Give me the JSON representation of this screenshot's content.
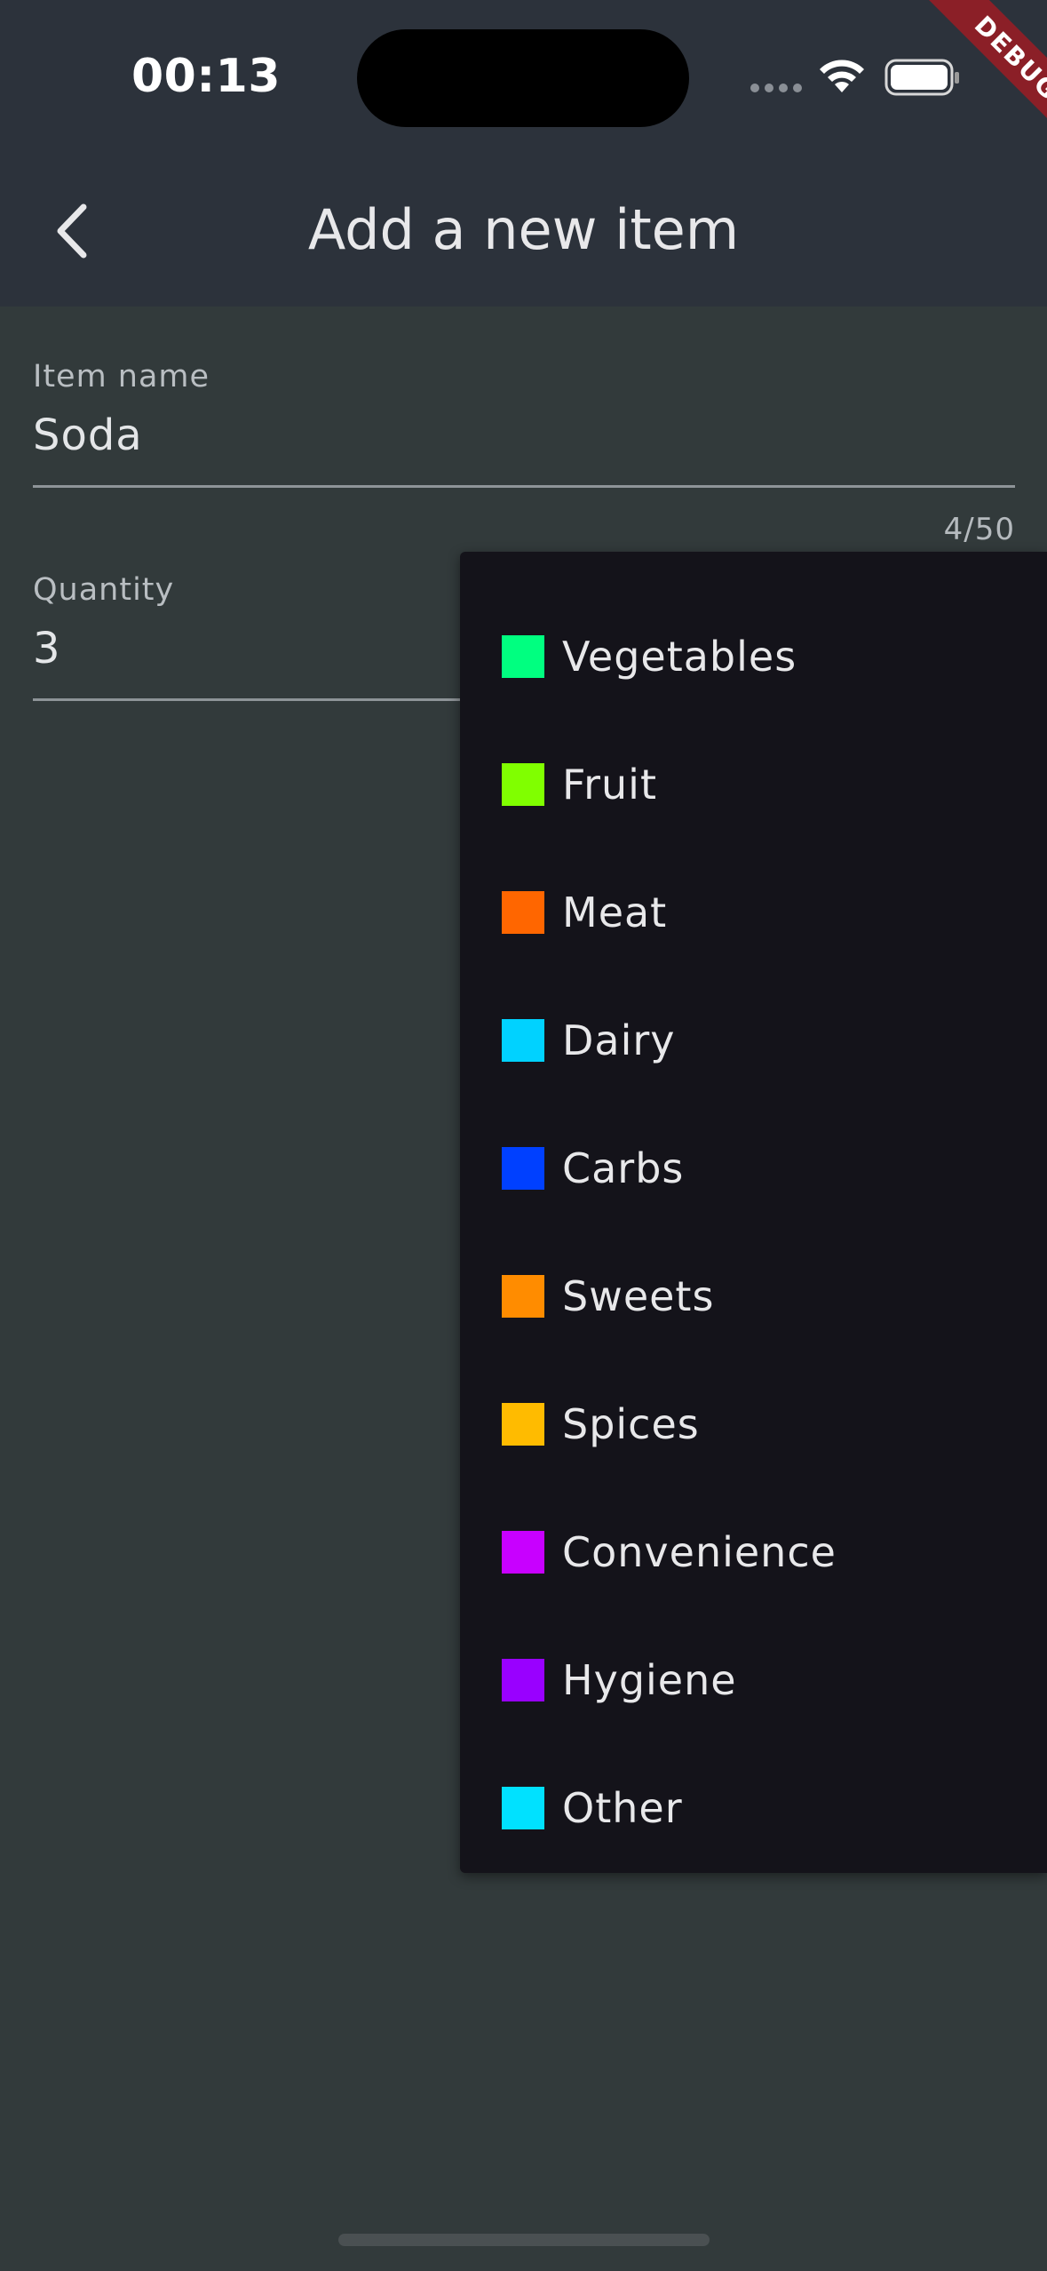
{
  "status_bar": {
    "time": "00:13"
  },
  "debug_banner": "DEBUG",
  "app_bar": {
    "title": "Add a new item",
    "back_icon": "chevron-left-icon"
  },
  "form": {
    "item_name": {
      "label": "Item name",
      "value": "Soda",
      "counter": "4/50"
    },
    "quantity": {
      "label": "Quantity",
      "value": "3"
    }
  },
  "category_dropdown": {
    "options": [
      {
        "label": "Vegetables",
        "color": "#00ff80"
      },
      {
        "label": "Fruit",
        "color": "#80ff00"
      },
      {
        "label": "Meat",
        "color": "#ff6600"
      },
      {
        "label": "Dairy",
        "color": "#00d2ff"
      },
      {
        "label": "Carbs",
        "color": "#0040ff"
      },
      {
        "label": "Sweets",
        "color": "#ff8c00"
      },
      {
        "label": "Spices",
        "color": "#ffbb00"
      },
      {
        "label": "Convenience",
        "color": "#c800ff"
      },
      {
        "label": "Hygiene",
        "color": "#9900ff"
      },
      {
        "label": "Other",
        "color": "#00e1ff"
      }
    ]
  }
}
